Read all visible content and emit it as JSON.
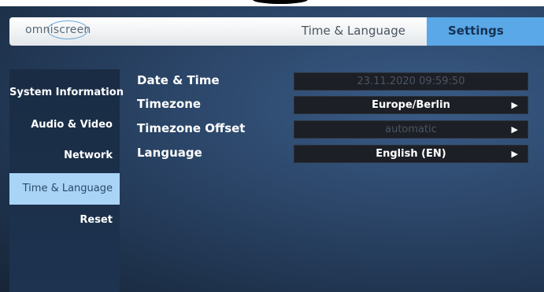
{
  "header": {
    "logo_text": "omniscreen",
    "page_title": "Time & Language",
    "active_tab": "Settings"
  },
  "sidebar": {
    "items": [
      {
        "label": "System Information",
        "active": false
      },
      {
        "label": "Audio & Video",
        "active": false
      },
      {
        "label": "Network",
        "active": false
      },
      {
        "label": "Time & Language",
        "active": true
      },
      {
        "label": "Reset",
        "active": false
      }
    ]
  },
  "settings": {
    "date_time": {
      "label": "Date & Time",
      "value": "23.11.2020 09:59:50"
    },
    "timezone": {
      "label": "Timezone",
      "value": "Europe/Berlin"
    },
    "timezone_offset": {
      "label": "Timezone Offset",
      "value": "automatic"
    },
    "language": {
      "label": "Language",
      "value": "English (EN)"
    },
    "arrow_icon": "play-triangle-icon"
  }
}
